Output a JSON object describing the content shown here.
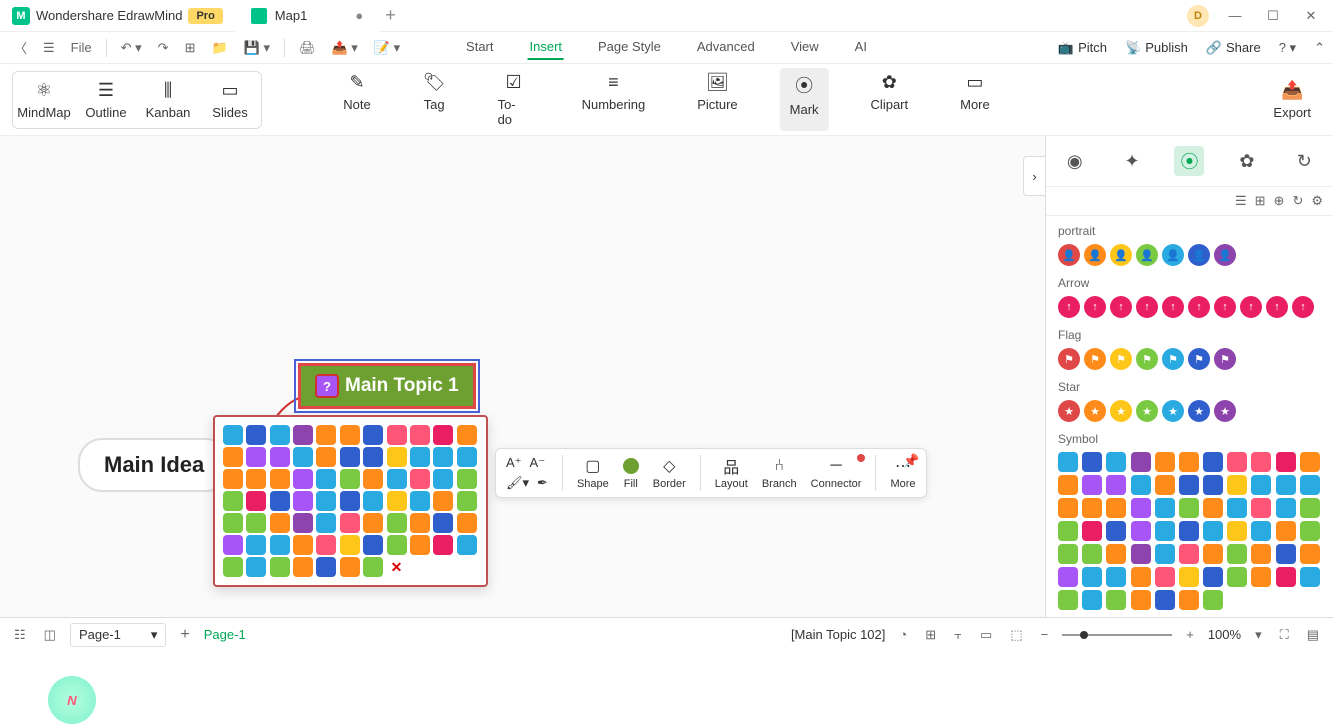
{
  "app": {
    "name": "Wondershare EdrawMind",
    "badge": "Pro",
    "doc": "Map1",
    "avatar": "D"
  },
  "menu": {
    "tabs": [
      "Start",
      "Insert",
      "Page Style",
      "Advanced",
      "View",
      "AI"
    ],
    "active": 1
  },
  "rightActions": {
    "pitch": "Pitch",
    "publish": "Publish",
    "share": "Share"
  },
  "views": [
    "MindMap",
    "Outline",
    "Kanban",
    "Slides"
  ],
  "ribbon": {
    "items": [
      "Note",
      "Tag",
      "To-do",
      "Numbering",
      "Picture",
      "Mark",
      "Clipart",
      "More"
    ],
    "sel": 5,
    "export": "Export"
  },
  "file_label": "File",
  "nodes": {
    "main": "Main Idea",
    "topic": "Main Topic 1",
    "mark": "?"
  },
  "floatbar": {
    "shape": "Shape",
    "fill": "Fill",
    "border": "Border",
    "layout": "Layout",
    "branch": "Branch",
    "connector": "Connector",
    "more": "More"
  },
  "sidepanel": {
    "sections": {
      "portrait": "portrait",
      "arrow": "Arrow",
      "flag": "Flag",
      "star": "Star",
      "symbol": "Symbol"
    },
    "portrait_colors": [
      "#e04848",
      "#ff8c1a",
      "#ffc61a",
      "#7ac943",
      "#29abe2",
      "#2e5fcc",
      "#8e44ad"
    ],
    "arrow_colors": [
      "#e91e63",
      "#e91e63",
      "#e91e63",
      "#e91e63",
      "#e91e63",
      "#e91e63",
      "#e91e63",
      "#e91e63",
      "#e91e63",
      "#e91e63"
    ],
    "flag_colors": [
      "#e04848",
      "#ff8c1a",
      "#ffc61a",
      "#7ac943",
      "#29abe2",
      "#2e5fcc",
      "#8e44ad"
    ],
    "star_colors": [
      "#e04848",
      "#ff8c1a",
      "#ffc61a",
      "#7ac943",
      "#29abe2",
      "#2e5fcc",
      "#8e44ad"
    ]
  },
  "status": {
    "page_sel": "Page-1",
    "page_tab": "Page-1",
    "selection": "[Main Topic 102]",
    "zoom": "100%"
  },
  "symbol_colors": [
    "#29abe2",
    "#2e5fcc",
    "#29abe2",
    "#8e44ad",
    "#ff8c1a",
    "#ff8c1a",
    "#2e5fcc",
    "#ff5577",
    "#ff5577",
    "#e91e63",
    "#ff8c1a",
    "#ff8c1a",
    "#a855f7",
    "#a855f7",
    "#29abe2",
    "#ff8c1a",
    "#2e5fcc",
    "#2e5fcc",
    "#ffc61a",
    "#29abe2",
    "#29abe2",
    "#29abe2",
    "#ff8c1a",
    "#ff8c1a",
    "#ff8c1a",
    "#a855f7",
    "#29abe2",
    "#7ac943",
    "#ff8c1a",
    "#29abe2",
    "#ff5577",
    "#29abe2",
    "#7ac943",
    "#7ac943",
    "#e91e63",
    "#2e5fcc",
    "#a855f7",
    "#29abe2",
    "#2e5fcc",
    "#29abe2",
    "#ffc61a",
    "#29abe2",
    "#ff8c1a",
    "#7ac943",
    "#7ac943",
    "#7ac943",
    "#ff8c1a",
    "#8e44ad",
    "#29abe2",
    "#ff5577",
    "#ff8c1a",
    "#7ac943",
    "#ff8c1a",
    "#2e5fcc",
    "#ff8c1a",
    "#a855f7",
    "#29abe2",
    "#29abe2",
    "#ff8c1a",
    "#ff5577",
    "#ffc61a",
    "#2e5fcc",
    "#7ac943",
    "#ff8c1a",
    "#e91e63",
    "#29abe2",
    "#7ac943",
    "#29abe2",
    "#7ac943",
    "#ff8c1a",
    "#2e5fcc",
    "#ff8c1a",
    "#7ac943"
  ]
}
